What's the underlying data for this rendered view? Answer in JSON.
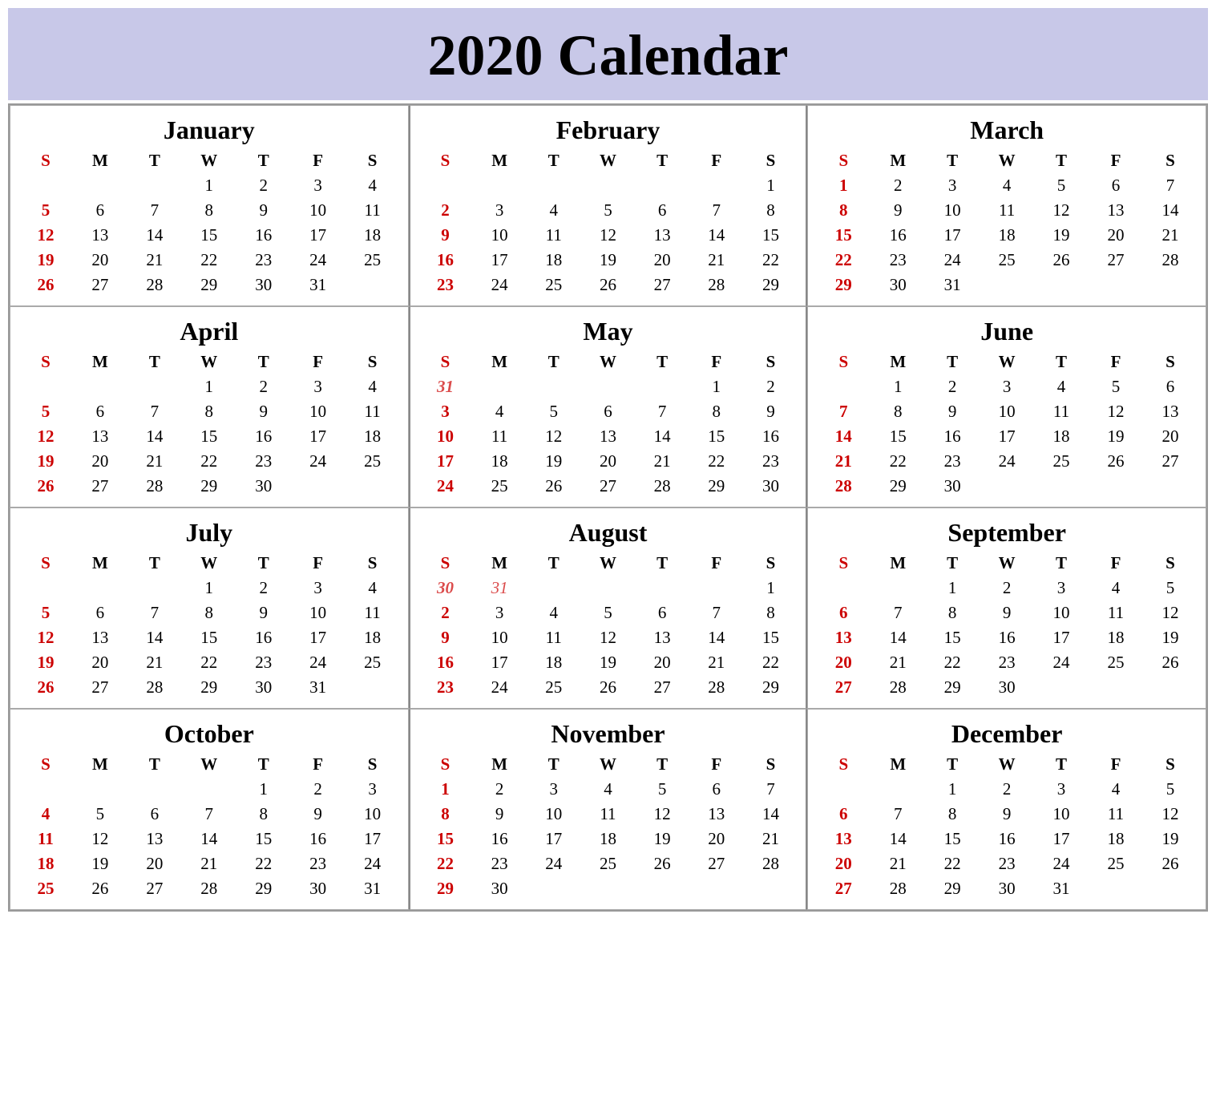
{
  "title": "2020 Calendar",
  "months": [
    {
      "name": "January",
      "weeks": [
        [
          "",
          "",
          "",
          "1",
          "2",
          "3",
          "4"
        ],
        [
          "5",
          "6",
          "7",
          "8",
          "9",
          "10",
          "11"
        ],
        [
          "12",
          "13",
          "14",
          "15",
          "16",
          "17",
          "18"
        ],
        [
          "19",
          "20",
          "21",
          "22",
          "23",
          "24",
          "25"
        ],
        [
          "26",
          "27",
          "28",
          "29",
          "30",
          "31",
          ""
        ]
      ]
    },
    {
      "name": "February",
      "weeks": [
        [
          "",
          "",
          "",
          "",
          "",
          "",
          "1"
        ],
        [
          "2",
          "3",
          "4",
          "5",
          "6",
          "7",
          "8"
        ],
        [
          "9",
          "10",
          "11",
          "12",
          "13",
          "14",
          "15"
        ],
        [
          "16",
          "17",
          "18",
          "19",
          "20",
          "21",
          "22"
        ],
        [
          "23",
          "24",
          "25",
          "26",
          "27",
          "28",
          "29"
        ]
      ]
    },
    {
      "name": "March",
      "weeks": [
        [
          "1",
          "2",
          "3",
          "4",
          "5",
          "6",
          "7"
        ],
        [
          "8",
          "9",
          "10",
          "11",
          "12",
          "13",
          "14"
        ],
        [
          "15",
          "16",
          "17",
          "18",
          "19",
          "20",
          "21"
        ],
        [
          "22",
          "23",
          "24",
          "25",
          "26",
          "27",
          "28"
        ],
        [
          "29",
          "30",
          "31",
          "",
          "",
          "",
          ""
        ]
      ]
    },
    {
      "name": "April",
      "weeks": [
        [
          "",
          "",
          "",
          "1",
          "2",
          "3",
          "4"
        ],
        [
          "5",
          "6",
          "7",
          "8",
          "9",
          "10",
          "11"
        ],
        [
          "12",
          "13",
          "14",
          "15",
          "16",
          "17",
          "18"
        ],
        [
          "19",
          "20",
          "21",
          "22",
          "23",
          "24",
          "25"
        ],
        [
          "26",
          "27",
          "28",
          "29",
          "30",
          "",
          ""
        ]
      ]
    },
    {
      "name": "May",
      "weeks": [
        [
          "31",
          "",
          "",
          "",
          "",
          "1",
          "2"
        ],
        [
          "3",
          "4",
          "5",
          "6",
          "7",
          "8",
          "9"
        ],
        [
          "10",
          "11",
          "12",
          "13",
          "14",
          "15",
          "16"
        ],
        [
          "17",
          "18",
          "19",
          "20",
          "21",
          "22",
          "23"
        ],
        [
          "24",
          "25",
          "26",
          "27",
          "28",
          "29",
          "30"
        ]
      ]
    },
    {
      "name": "June",
      "weeks": [
        [
          "",
          "1",
          "2",
          "3",
          "4",
          "5",
          "6"
        ],
        [
          "7",
          "8",
          "9",
          "10",
          "11",
          "12",
          "13"
        ],
        [
          "14",
          "15",
          "16",
          "17",
          "18",
          "19",
          "20"
        ],
        [
          "21",
          "22",
          "23",
          "24",
          "25",
          "26",
          "27"
        ],
        [
          "28",
          "29",
          "30",
          "",
          "",
          "",
          ""
        ]
      ]
    },
    {
      "name": "July",
      "weeks": [
        [
          "",
          "",
          "",
          "1",
          "2",
          "3",
          "4"
        ],
        [
          "5",
          "6",
          "7",
          "8",
          "9",
          "10",
          "11"
        ],
        [
          "12",
          "13",
          "14",
          "15",
          "16",
          "17",
          "18"
        ],
        [
          "19",
          "20",
          "21",
          "22",
          "23",
          "24",
          "25"
        ],
        [
          "26",
          "27",
          "28",
          "29",
          "30",
          "31",
          ""
        ]
      ]
    },
    {
      "name": "August",
      "weeks": [
        [
          "30",
          "31",
          "",
          "",
          "",
          "",
          "1"
        ],
        [
          "2",
          "3",
          "4",
          "5",
          "6",
          "7",
          "8"
        ],
        [
          "9",
          "10",
          "11",
          "12",
          "13",
          "14",
          "15"
        ],
        [
          "16",
          "17",
          "18",
          "19",
          "20",
          "21",
          "22"
        ],
        [
          "23",
          "24",
          "25",
          "26",
          "27",
          "28",
          "29"
        ]
      ]
    },
    {
      "name": "September",
      "weeks": [
        [
          "",
          "",
          "1",
          "2",
          "3",
          "4",
          "5"
        ],
        [
          "6",
          "7",
          "8",
          "9",
          "10",
          "11",
          "12"
        ],
        [
          "13",
          "14",
          "15",
          "16",
          "17",
          "18",
          "19"
        ],
        [
          "20",
          "21",
          "22",
          "23",
          "24",
          "25",
          "26"
        ],
        [
          "27",
          "28",
          "29",
          "30",
          "",
          "",
          ""
        ]
      ]
    },
    {
      "name": "October",
      "weeks": [
        [
          "",
          "",
          "",
          "",
          "1",
          "2",
          "3"
        ],
        [
          "4",
          "5",
          "6",
          "7",
          "8",
          "9",
          "10"
        ],
        [
          "11",
          "12",
          "13",
          "14",
          "15",
          "16",
          "17"
        ],
        [
          "18",
          "19",
          "20",
          "21",
          "22",
          "23",
          "24"
        ],
        [
          "25",
          "26",
          "27",
          "28",
          "29",
          "30",
          "31"
        ]
      ]
    },
    {
      "name": "November",
      "weeks": [
        [
          "1",
          "2",
          "3",
          "4",
          "5",
          "6",
          "7"
        ],
        [
          "8",
          "9",
          "10",
          "11",
          "12",
          "13",
          "14"
        ],
        [
          "15",
          "16",
          "17",
          "18",
          "19",
          "20",
          "21"
        ],
        [
          "22",
          "23",
          "24",
          "25",
          "26",
          "27",
          "28"
        ],
        [
          "29",
          "30",
          "",
          "",
          "",
          "",
          ""
        ]
      ]
    },
    {
      "name": "December",
      "weeks": [
        [
          "",
          "",
          "1",
          "2",
          "3",
          "4",
          "5"
        ],
        [
          "6",
          "7",
          "8",
          "9",
          "10",
          "11",
          "12"
        ],
        [
          "13",
          "14",
          "15",
          "16",
          "17",
          "18",
          "19"
        ],
        [
          "20",
          "21",
          "22",
          "23",
          "24",
          "25",
          "26"
        ],
        [
          "27",
          "28",
          "29",
          "30",
          "31",
          "",
          ""
        ]
      ]
    }
  ],
  "days": [
    "S",
    "M",
    "T",
    "W",
    "T",
    "F",
    "S"
  ],
  "sunday_color": "#cc0000"
}
